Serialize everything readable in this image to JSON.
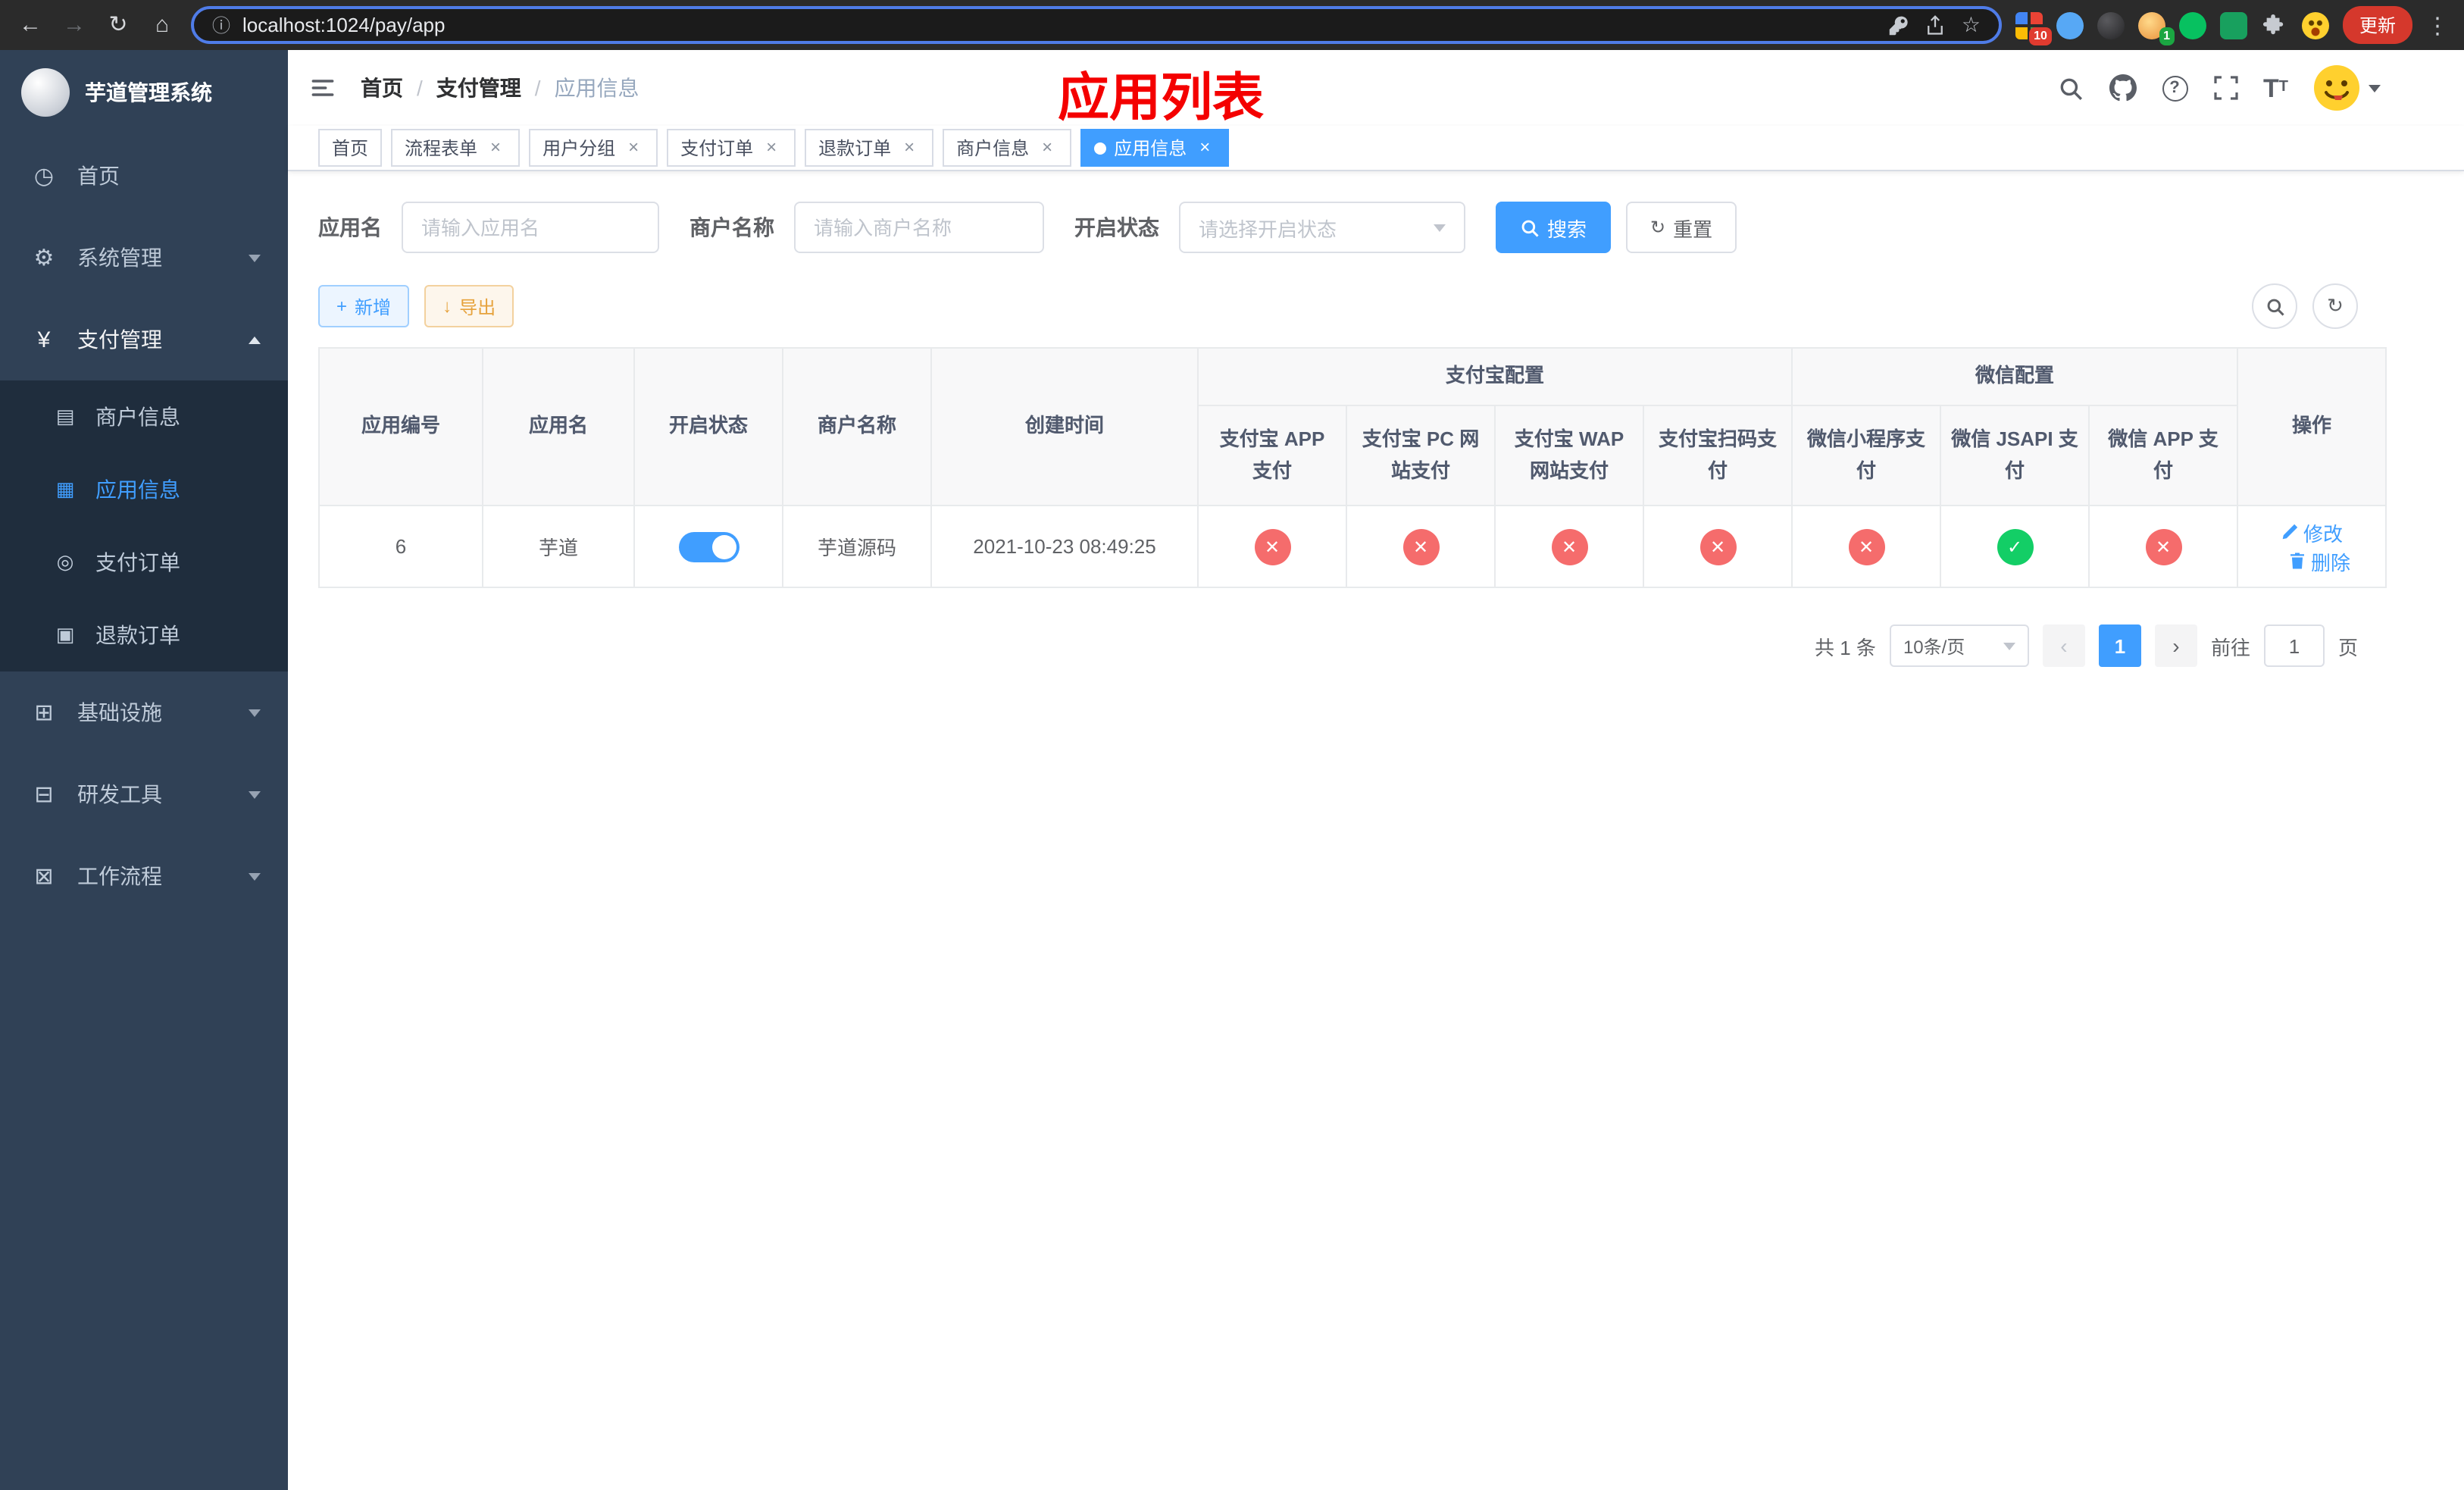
{
  "browser": {
    "url": "localhost:1024/pay/app",
    "update_button": "更新",
    "extension_badge_grid": "10",
    "extension_badge_avatar": "1"
  },
  "sidebar": {
    "app_title": "芋道管理系统",
    "menu": [
      {
        "label": "首页",
        "expandable": false
      },
      {
        "label": "系统管理",
        "expandable": true,
        "expanded": false
      },
      {
        "label": "支付管理",
        "expandable": true,
        "expanded": true
      },
      {
        "label": "基础设施",
        "expandable": true,
        "expanded": false
      },
      {
        "label": "研发工具",
        "expandable": true,
        "expanded": false
      },
      {
        "label": "工作流程",
        "expandable": true,
        "expanded": false
      }
    ],
    "payment_submenu": [
      {
        "label": "商户信息",
        "active": false
      },
      {
        "label": "应用信息",
        "active": true
      },
      {
        "label": "支付订单",
        "active": false
      },
      {
        "label": "退款订单",
        "active": false
      }
    ]
  },
  "header": {
    "breadcrumb": [
      "首页",
      "支付管理",
      "应用信息"
    ],
    "annotation_title": "应用列表"
  },
  "tags": [
    {
      "label": "首页",
      "closable": false,
      "active": false
    },
    {
      "label": "流程表单",
      "closable": true,
      "active": false
    },
    {
      "label": "用户分组",
      "closable": true,
      "active": false
    },
    {
      "label": "支付订单",
      "closable": true,
      "active": false
    },
    {
      "label": "退款订单",
      "closable": true,
      "active": false
    },
    {
      "label": "商户信息",
      "closable": true,
      "active": false
    },
    {
      "label": "应用信息",
      "closable": true,
      "active": true
    }
  ],
  "filters": {
    "app_name_label": "应用名",
    "app_name_placeholder": "请输入应用名",
    "merchant_label": "商户名称",
    "merchant_placeholder": "请输入商户名称",
    "status_label": "开启状态",
    "status_placeholder": "请选择开启状态",
    "search_button": "搜索",
    "reset_button": "重置"
  },
  "toolbar": {
    "add_button": "新增",
    "export_button": "导出"
  },
  "table": {
    "headers": {
      "app_id": "应用编号",
      "app_name": "应用名",
      "status": "开启状态",
      "merchant": "商户名称",
      "created": "创建时间",
      "alipay_group": "支付宝配置",
      "wechat_group": "微信配置",
      "alipay_app": "支付宝 APP 支付",
      "alipay_pc": "支付宝 PC 网站支付",
      "alipay_wap": "支付宝 WAP 网站支付",
      "alipay_qr": "支付宝扫码支付",
      "wx_lite": "微信小程序支付",
      "wx_jsapi": "微信 JSAPI 支付",
      "wx_app": "微信 APP 支付",
      "actions": "操作"
    },
    "rows": [
      {
        "id": "6",
        "name": "芋道",
        "enabled": true,
        "merchant": "芋道源码",
        "created": "2021-10-23 08:49:25",
        "config": {
          "alipay_app": false,
          "alipay_pc": false,
          "alipay_wap": false,
          "alipay_qr": false,
          "wx_lite": false,
          "wx_jsapi": true,
          "wx_app": false
        },
        "edit_label": "修改",
        "delete_label": "删除"
      }
    ]
  },
  "pagination": {
    "total": "共 1 条",
    "page_size": "10条/页",
    "page": "1",
    "goto_label": "前往",
    "goto_value": "1",
    "unit_label": "页"
  },
  "colors": {
    "primary": "#409eff",
    "success": "#13ce66",
    "danger": "#f56c6c",
    "warning": "#e6a23c",
    "sidebar_bg": "#304156",
    "submenu_bg": "#1f2d3d",
    "annotation_red": "#f40000"
  }
}
